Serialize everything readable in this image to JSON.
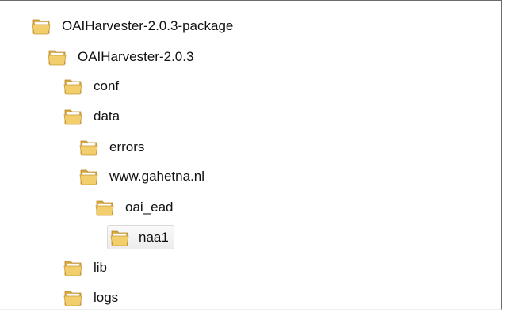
{
  "tree": {
    "items": [
      {
        "label": "OAIHarvester-2.0.3-package",
        "depth": 0,
        "selected": false
      },
      {
        "label": "OAIHarvester-2.0.3",
        "depth": 1,
        "selected": false
      },
      {
        "label": "conf",
        "depth": 2,
        "selected": false
      },
      {
        "label": "data",
        "depth": 2,
        "selected": false
      },
      {
        "label": "errors",
        "depth": 3,
        "selected": false
      },
      {
        "label": "www.gahetna.nl",
        "depth": 3,
        "selected": false
      },
      {
        "label": "oai_ead",
        "depth": 4,
        "selected": false
      },
      {
        "label": "naa1",
        "depth": 5,
        "selected": true
      },
      {
        "label": "lib",
        "depth": 2,
        "selected": false
      },
      {
        "label": "logs",
        "depth": 2,
        "selected": false
      }
    ]
  },
  "icons": {
    "folder": "folder-icon"
  },
  "colors": {
    "folder_front": "#f2cf6c",
    "folder_back": "#d9a73a",
    "folder_outline": "#b88a2a",
    "paper": "#ffffff",
    "selection_border": "#d9d9d9",
    "frame_border": "#6b6b6b"
  }
}
